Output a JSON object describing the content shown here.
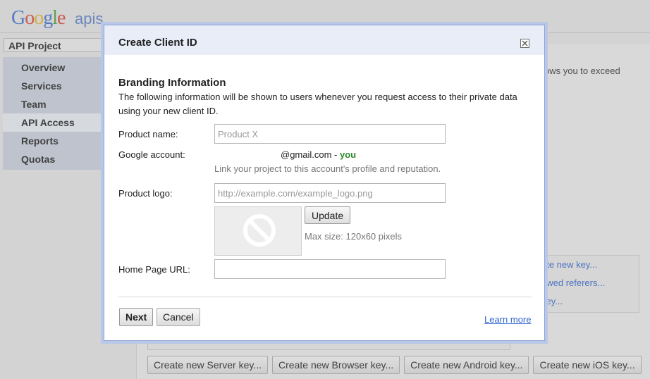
{
  "header": {
    "logo_text": "Google",
    "logo_suffix": "apis"
  },
  "sidebar": {
    "project": "API Project",
    "items": [
      {
        "label": "Overview"
      },
      {
        "label": "Services"
      },
      {
        "label": "Team"
      },
      {
        "label": "API Access"
      },
      {
        "label": "Reports"
      },
      {
        "label": "Quotas"
      }
    ]
  },
  "background": {
    "partial_text": "ows you to exceed",
    "key_links": [
      "ate new key...",
      "owed referers...",
      "key..."
    ],
    "buttons": [
      "Create new Server key...",
      "Create new Browser key...",
      "Create new Android key...",
      "Create new iOS key..."
    ]
  },
  "dialog": {
    "title": "Create Client ID",
    "section_title": "Branding Information",
    "section_desc": "The following information will be shown to users whenever you request access to their private data using your new client ID.",
    "product_name": {
      "label": "Product name:",
      "placeholder": "Product X",
      "value": ""
    },
    "google_account": {
      "label": "Google account:",
      "email": "@gmail.com",
      "separator": " - ",
      "you": "you",
      "hint": "Link your project to this account's profile and reputation."
    },
    "product_logo": {
      "label": "Product logo:",
      "placeholder": "http://example.com/example_logo.png",
      "value": "",
      "update_label": "Update",
      "max_size": "Max size: 120x60 pixels"
    },
    "home_page": {
      "label": "Home Page URL:",
      "value": ""
    },
    "next_label": "Next",
    "cancel_label": "Cancel",
    "learn_more": "Learn more"
  }
}
